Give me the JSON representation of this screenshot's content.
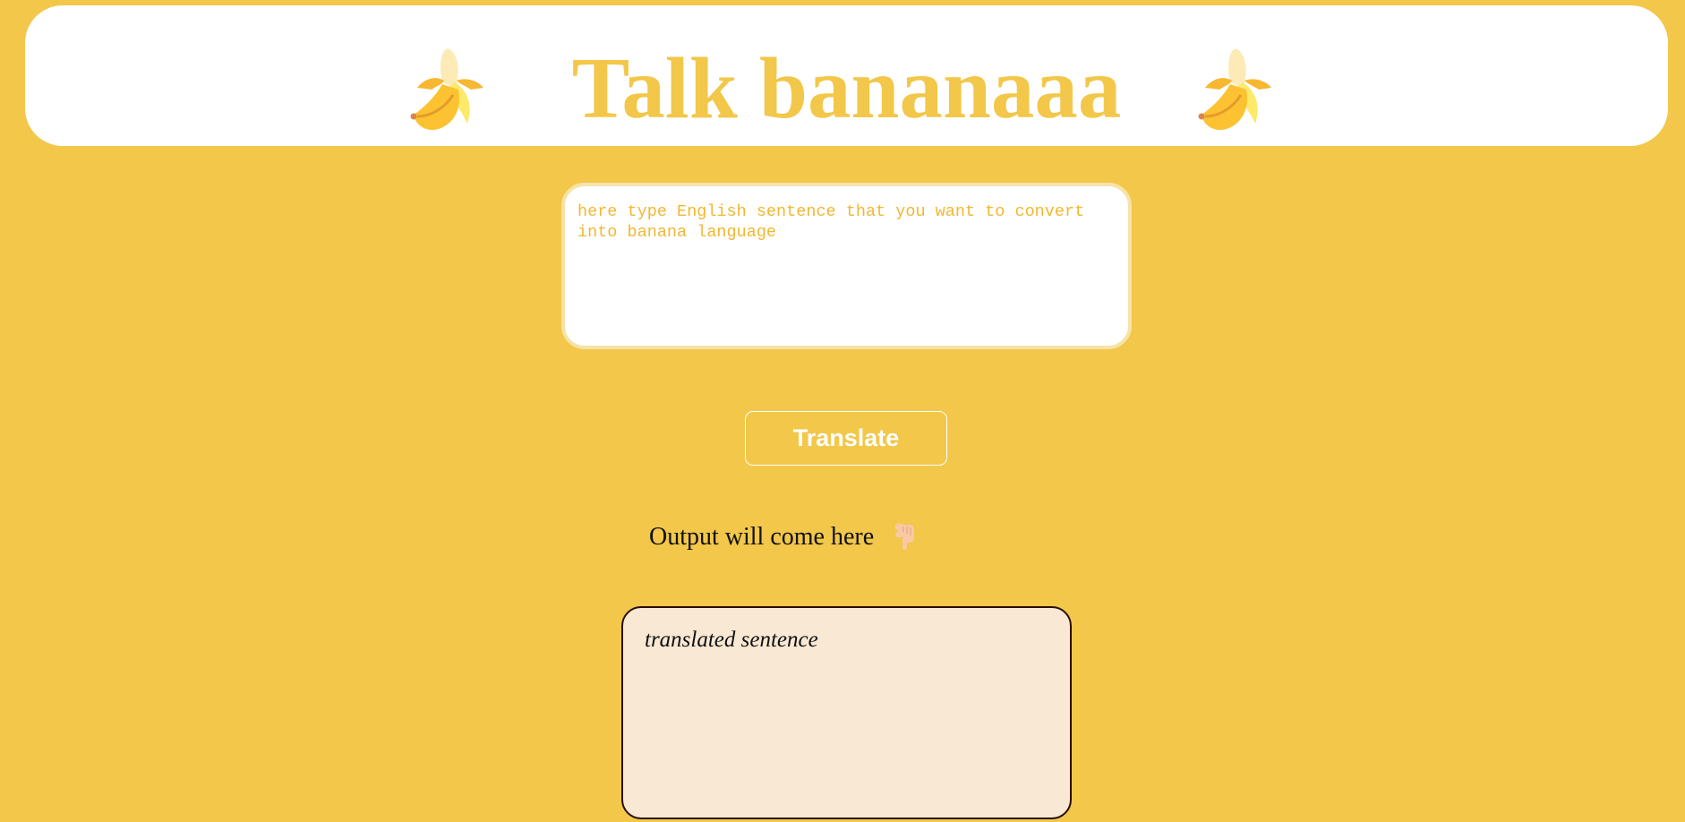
{
  "header": {
    "title": "Talk bananaaa",
    "icon": "banana-icon"
  },
  "input": {
    "placeholder": "here type English sentence that you want to convert into banana language",
    "value": ""
  },
  "translate_button": {
    "label": "Translate"
  },
  "output": {
    "label": "Output will come here",
    "label_icon": "pointing-down-icon",
    "text": "translated sentence"
  },
  "colors": {
    "background": "#f2c74a",
    "header_bg": "#ffffff",
    "title": "#f2c74a",
    "input_text": "#f2b731",
    "output_bg": "#f9e8d3",
    "output_border": "#2a0e0e"
  }
}
